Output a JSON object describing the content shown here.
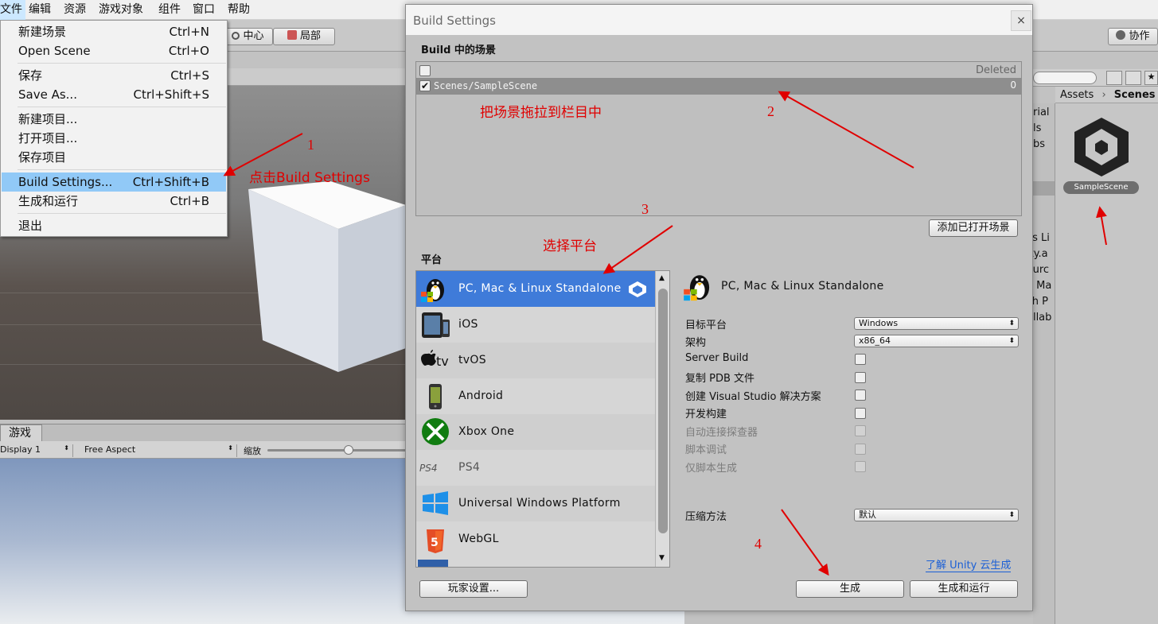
{
  "menubar": {
    "items": [
      "文件",
      "编辑",
      "资源",
      "游戏对象",
      "组件",
      "窗口",
      "帮助"
    ]
  },
  "toolbar": {
    "center_label": "中心",
    "local_label": "局部",
    "collab_label": "协作"
  },
  "file_menu": {
    "items": [
      {
        "label": "新建场景",
        "shortcut": "Ctrl+N"
      },
      {
        "label": "Open Scene",
        "shortcut": "Ctrl+O"
      },
      {
        "label": "保存",
        "shortcut": "Ctrl+S"
      },
      {
        "label": "Save As...",
        "shortcut": "Ctrl+Shift+S"
      },
      {
        "label": "新建项目...",
        "shortcut": ""
      },
      {
        "label": "打开项目...",
        "shortcut": ""
      },
      {
        "label": "保存项目",
        "shortcut": ""
      },
      {
        "label": "Build Settings...",
        "shortcut": "Ctrl+Shift+B"
      },
      {
        "label": "生成和运行",
        "shortcut": "Ctrl+B"
      },
      {
        "label": "退出",
        "shortcut": ""
      }
    ]
  },
  "game_panel": {
    "tab_label": "游戏",
    "display": "Display 1",
    "aspect": "Free Aspect",
    "scale_label": "缩放"
  },
  "project_panel": {
    "breadcrumb_root": "Assets",
    "breadcrumb_current": "Scenes",
    "asset_name": "SampleScene",
    "truncated_items": [
      "erial",
      "els",
      "abs",
      "cs Li",
      "ity.a",
      "Purc",
      "e Ma",
      "sh P",
      "ollab"
    ]
  },
  "dialog": {
    "title": "Build Settings",
    "close_label": "×",
    "scenes_header": "Build 中的场景",
    "deleted_label": "Deleted",
    "scene": {
      "path": "Scenes/SampleScene",
      "index": "0",
      "checked": true
    },
    "add_open_scenes_label": "添加已打开场景",
    "platform_header": "平台",
    "platforms": [
      "PC, Mac & Linux Standalone",
      "iOS",
      "tvOS",
      "Android",
      "Xbox One",
      "PS4",
      "Universal Windows Platform",
      "WebGL"
    ],
    "selected_platform": "PC, Mac & Linux Standalone",
    "options": {
      "target_platform_label": "目标平台",
      "target_platform_value": "Windows",
      "architecture_label": "架构",
      "architecture_value": "x86_64",
      "server_build": "Server Build",
      "copy_pdb": "复制 PDB 文件",
      "vs_solution": "创建 Visual Studio 解决方案",
      "dev_build": "开发构建",
      "autoconnect_profiler": "自动连接探查器",
      "script_debugging": "脚本调试",
      "scripts_only": "仅脚本生成",
      "compression_label": "压缩方法",
      "compression_value": "默认"
    },
    "cloud_build_link": "了解 Unity 云生成",
    "player_settings_label": "玩家设置...",
    "build_label": "生成",
    "build_and_run_label": "生成和运行"
  },
  "annotations": {
    "n1": "1",
    "t1": "点击Build Settings",
    "n2": "2",
    "t2": "把场景拖拉到栏目中",
    "n3": "3",
    "t3": "选择平台",
    "n4": "4"
  },
  "colors": {
    "annotation_red": "#e00000",
    "menu_highlight": "#91c9f7",
    "platform_selected": "#3f7bd9",
    "link_blue": "#1a5fd6"
  }
}
